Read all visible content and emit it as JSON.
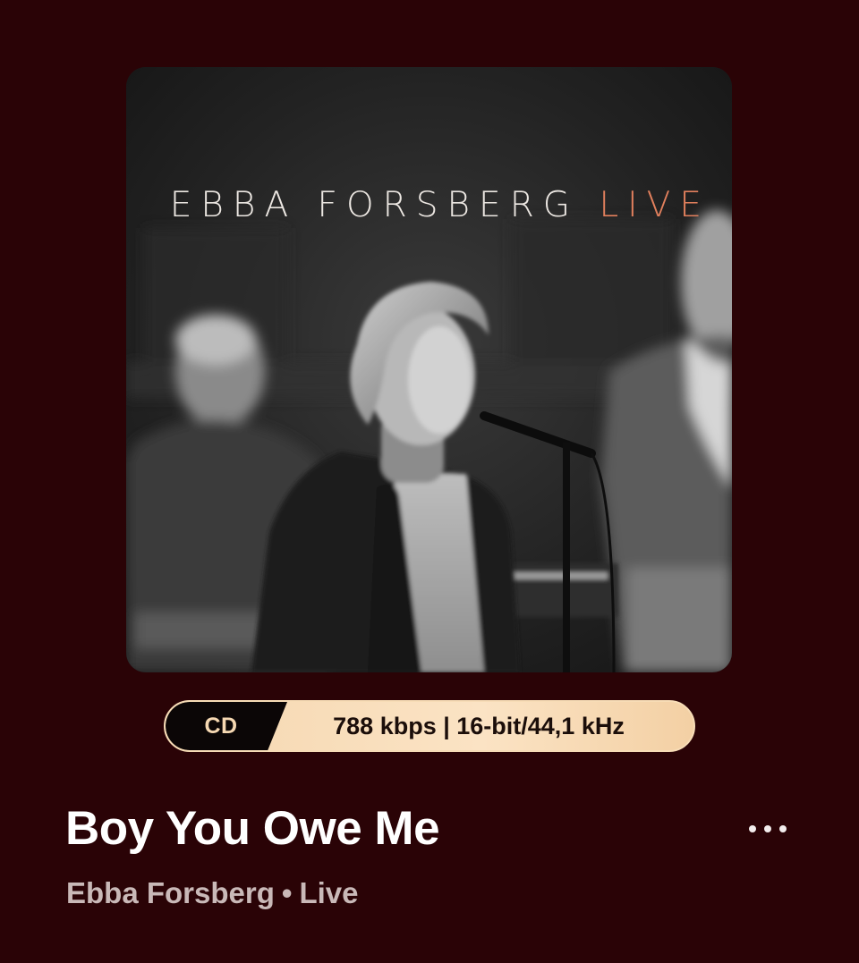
{
  "album_art": {
    "title_main": "EBBA FORSBERG",
    "title_accent": "LIVE"
  },
  "quality": {
    "format": "CD",
    "details": "788 kbps | 16-bit/44,1 kHz"
  },
  "track": {
    "title": "Boy You Owe Me",
    "artist": "Ebba Forsberg",
    "separator": "•",
    "album": "Live"
  },
  "icons": {
    "more": "more-horizontal-icon"
  },
  "colors": {
    "background": "#2a0306",
    "accent": "#e2805d",
    "pill": "#f5d7b0",
    "subtitle": "#c9b9b8"
  }
}
